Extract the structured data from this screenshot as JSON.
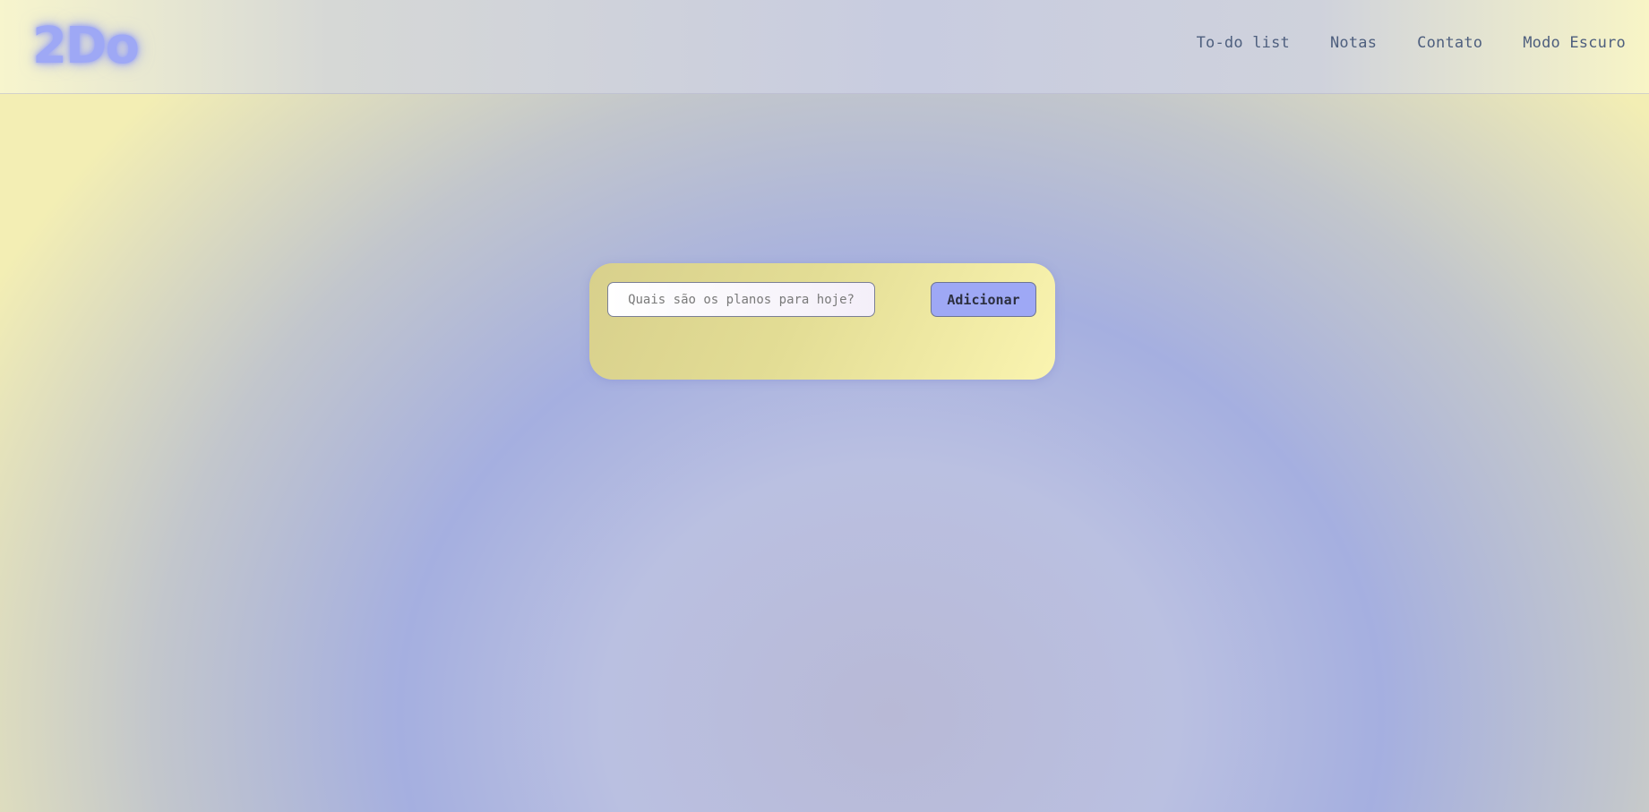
{
  "header": {
    "logo": "2Do",
    "nav": [
      {
        "label": "To-do list"
      },
      {
        "label": "Notas"
      },
      {
        "label": "Contato"
      },
      {
        "label": "Modo Escuro"
      }
    ]
  },
  "todo": {
    "input_placeholder": "Quais são os planos para hoje?",
    "input_value": "",
    "add_label": "Adicionar"
  },
  "colors": {
    "accent": "#9ea8f5",
    "card_yellow": "#e3dd95",
    "nav_text": "#4e5f7e"
  }
}
